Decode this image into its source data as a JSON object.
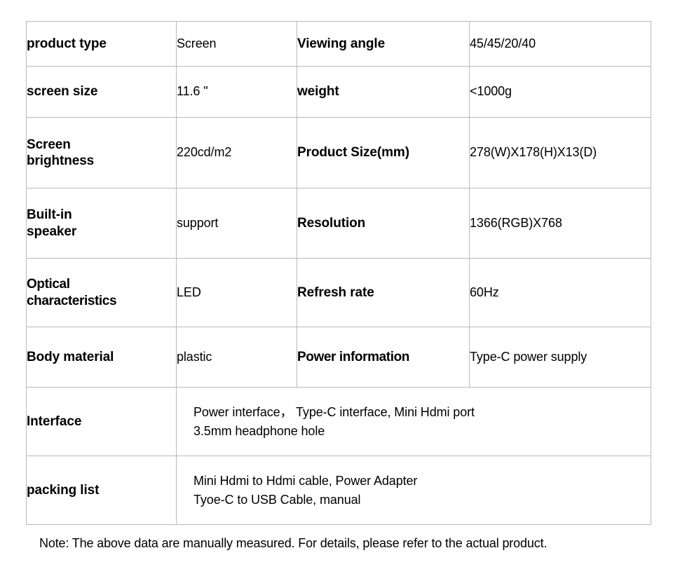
{
  "table": {
    "rows": [
      {
        "kind": "pair",
        "label_left": "product type",
        "value_left": "Screen",
        "label_right": "Viewing angle",
        "value_right": "45/45/20/40"
      },
      {
        "kind": "pair",
        "label_left": "screen size",
        "value_left": "11.6 \"",
        "label_right": "weight",
        "value_right": "<1000g"
      },
      {
        "kind": "pair",
        "label_left": "Screen\nbrightness",
        "value_left": "220cd/m2",
        "label_right": "Product Size(mm)",
        "value_right": "278(W)X178(H)X13(D)"
      },
      {
        "kind": "pair",
        "label_left": "Built-in\nspeaker",
        "value_left": "support",
        "label_right": "Resolution",
        "value_right": "1366(RGB)X768"
      },
      {
        "kind": "pair",
        "label_left": "Optical\ncharacteristics",
        "value_left": "LED",
        "label_right": "Refresh rate",
        "value_right": "60Hz"
      },
      {
        "kind": "pair",
        "label_left": "Body material",
        "value_left": "plastic",
        "label_right": "Power information",
        "value_right": "Type-C power supply"
      },
      {
        "kind": "span",
        "label_left": "Interface",
        "value_span": "Power interface，  Type-C interface, Mini Hdmi port\n3.5mm headphone hole"
      },
      {
        "kind": "span",
        "label_left": "packing list",
        "value_span": "Mini Hdmi to Hdmi cable, Power Adapter\nTyoe-C to USB Cable,  manual"
      }
    ]
  },
  "footnote": {
    "text": "Note: The above data are manually measured. For details, please refer to the actual product."
  },
  "colors": {
    "text": "#000000",
    "outer_border": "#8c8c8c",
    "inner_border": "#b9b9b9",
    "background": "#ffffff"
  }
}
